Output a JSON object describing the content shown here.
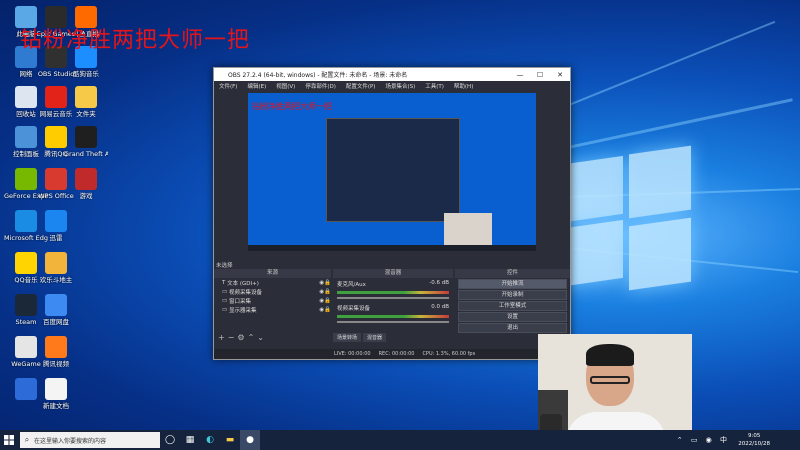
{
  "overlay": {
    "title": "钻粉净胜两把大师一把"
  },
  "desktop_icons": [
    {
      "label": "此电脑",
      "color": "#5aa9e6"
    },
    {
      "label": "网络",
      "color": "#2f7bd1"
    },
    {
      "label": "回收站",
      "color": "#dde6f0"
    },
    {
      "label": "控制面板",
      "color": "#4b92d9"
    },
    {
      "label": "GeForce Experience",
      "color": "#76b900"
    },
    {
      "label": "Microsoft Edge",
      "color": "#1b8ce3"
    },
    {
      "label": "QQ音乐",
      "color": "#ffd400"
    },
    {
      "label": "Steam",
      "color": "#1b2838"
    },
    {
      "label": "WeGame",
      "color": "#e5e5e5"
    },
    {
      "label": "",
      "color": "#2c6bd8"
    },
    {
      "label": "Epic Games",
      "color": "#2b2b2b"
    },
    {
      "label": "OBS Studio",
      "color": "#303030"
    },
    {
      "label": "网易云音乐",
      "color": "#e2231a"
    },
    {
      "label": "腾讯QQ",
      "color": "#ffcc00"
    },
    {
      "label": "WPS Office",
      "color": "#d93a30"
    },
    {
      "label": "迅雷",
      "color": "#1b86f0"
    },
    {
      "label": "欢乐斗地主",
      "color": "#f3b43c"
    },
    {
      "label": "百度网盘",
      "color": "#3d8bf2"
    },
    {
      "label": "腾讯视频",
      "color": "#ff7a1a"
    },
    {
      "label": "新建文档",
      "color": "#f4f4f4"
    },
    {
      "label": "斗鱼直播",
      "color": "#ff6a00"
    },
    {
      "label": "酷狗音乐",
      "color": "#1c8eff"
    },
    {
      "label": "文件夹",
      "color": "#f7c948"
    },
    {
      "label": "Grand Theft Auto V",
      "color": "#1f1f1f"
    },
    {
      "label": "游戏",
      "color": "#c02a2a"
    }
  ],
  "obs": {
    "title": "OBS 27.2.4 (64-bit, windows) - 配置文件: 未命名 - 场景: 未命名",
    "menu": [
      "文件(F)",
      "编辑(E)",
      "视图(V)",
      "停靠部件(D)",
      "配置文件(P)",
      "场景集合(S)",
      "工具(T)",
      "帮助(H)"
    ],
    "preview_title": "钻粉净胜两把大师一把",
    "panels": {
      "scenes_label": "来源",
      "mixer_label": "混音器",
      "controls_label": "控件",
      "current_scene": "未选择"
    },
    "sources": [
      {
        "name": "文本 (GDI+)",
        "icon": "T"
      },
      {
        "name": "视频采集设备",
        "icon": "▭"
      },
      {
        "name": "窗口采集",
        "icon": "▭"
      },
      {
        "name": "显示器采集",
        "icon": "▭"
      }
    ],
    "mixer": [
      {
        "name": "麦克风/Aux",
        "level": "-0.6 dB"
      },
      {
        "name": "视频采集设备",
        "level": "0.0 dB"
      }
    ],
    "controls": [
      "开始推流",
      "开始录制",
      "工作室模式",
      "设置",
      "退出"
    ],
    "tabs": [
      "场景转场",
      "混音器"
    ],
    "status": {
      "live": "LIVE: 00:00:00",
      "rec": "REC: 00:00:00",
      "cpu": "CPU: 1.3%, 60.00 fps"
    }
  },
  "taskbar": {
    "search_placeholder": "在这里输入你要搜索的内容",
    "time": "9:05",
    "date": "2022/10/28"
  }
}
